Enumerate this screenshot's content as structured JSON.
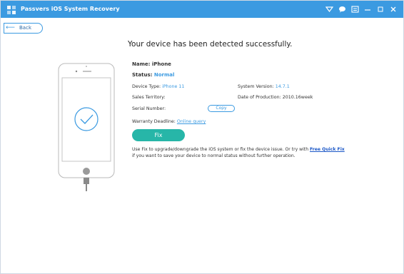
{
  "window": {
    "title": "Passvers iOS System Recovery",
    "icons": [
      "feedback-icon",
      "chat-icon",
      "menu-icon",
      "minimize-icon",
      "restore-icon",
      "close-icon"
    ]
  },
  "nav": {
    "back_label": "Back"
  },
  "main": {
    "headline": "Your device has been detected successfully.",
    "name_label": "Name:",
    "name_value": "iPhone",
    "status_label": "Status:",
    "status_value": "Normal",
    "device_type_label": "Device Type:",
    "device_type_value": "iPhone 11",
    "system_version_label": "System Version:",
    "system_version_value": "14.7.1",
    "sales_territory_label": "Sales Territory:",
    "sales_territory_value": "",
    "production_date_label": "Date of Production:",
    "production_date_value": "2010.16week",
    "serial_label": "Serial Number:",
    "copy_label": "Copy",
    "warranty_label": "Warranty Deadline:",
    "warranty_link": "Online query",
    "fix_label": "Fix",
    "desc_part1": "Use Fix to upgrade/downgrade the iOS system or fix the device issue. Or try with ",
    "desc_link": "Free Quick Fix",
    "desc_part2": " if you want to save your device to normal status without further operation."
  },
  "colors": {
    "accent": "#3b9ae1",
    "fix_button": "#27b6a8",
    "link_strong": "#1b57c7"
  }
}
